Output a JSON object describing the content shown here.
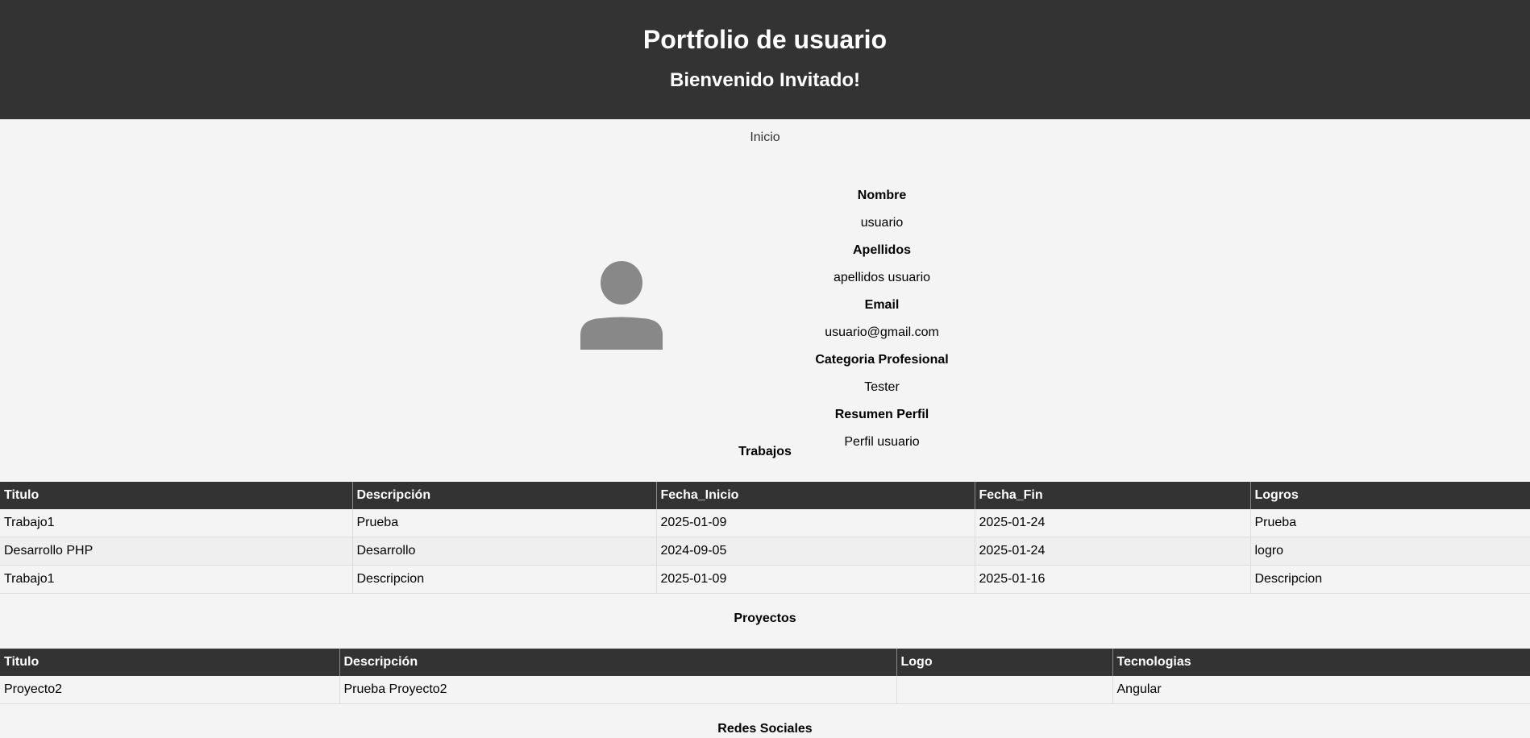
{
  "header": {
    "title": "Portfolio de usuario",
    "subtitle": "Bienvenido Invitado!"
  },
  "nav": {
    "home": "Inicio"
  },
  "profile": {
    "fields": [
      {
        "label": "Nombre",
        "value": "usuario"
      },
      {
        "label": "Apellidos",
        "value": "apellidos usuario"
      },
      {
        "label": "Email",
        "value": "usuario@gmail.com"
      },
      {
        "label": "Categoria Profesional",
        "value": "Tester"
      },
      {
        "label": "Resumen Perfil",
        "value": "Perfil usuario"
      }
    ],
    "avatar_icon": "user-silhouette-icon",
    "avatar_color": "#888888"
  },
  "trabajos": {
    "title": "Trabajos",
    "headers": [
      "Titulo",
      "Descripción",
      "Fecha_Inicio",
      "Fecha_Fin",
      "Logros"
    ],
    "rows": [
      [
        "Trabajo1",
        "Prueba",
        "2025-01-09",
        "2025-01-24",
        "Prueba"
      ],
      [
        "Desarrollo PHP",
        "Desarrollo",
        "2024-09-05",
        "2025-01-24",
        "logro"
      ],
      [
        "Trabajo1",
        "Descripcion",
        "2025-01-09",
        "2025-01-16",
        "Descripcion"
      ]
    ]
  },
  "proyectos": {
    "title": "Proyectos",
    "headers": [
      "Titulo",
      "Descripción",
      "Logo",
      "Tecnologias"
    ],
    "rows": [
      [
        "Proyecto2",
        "Prueba Proyecto2",
        "",
        "Angular"
      ]
    ]
  },
  "redes": {
    "title": "Redes Sociales"
  },
  "colors": {
    "header_bg": "#333333",
    "page_bg": "#f4f4f4"
  }
}
